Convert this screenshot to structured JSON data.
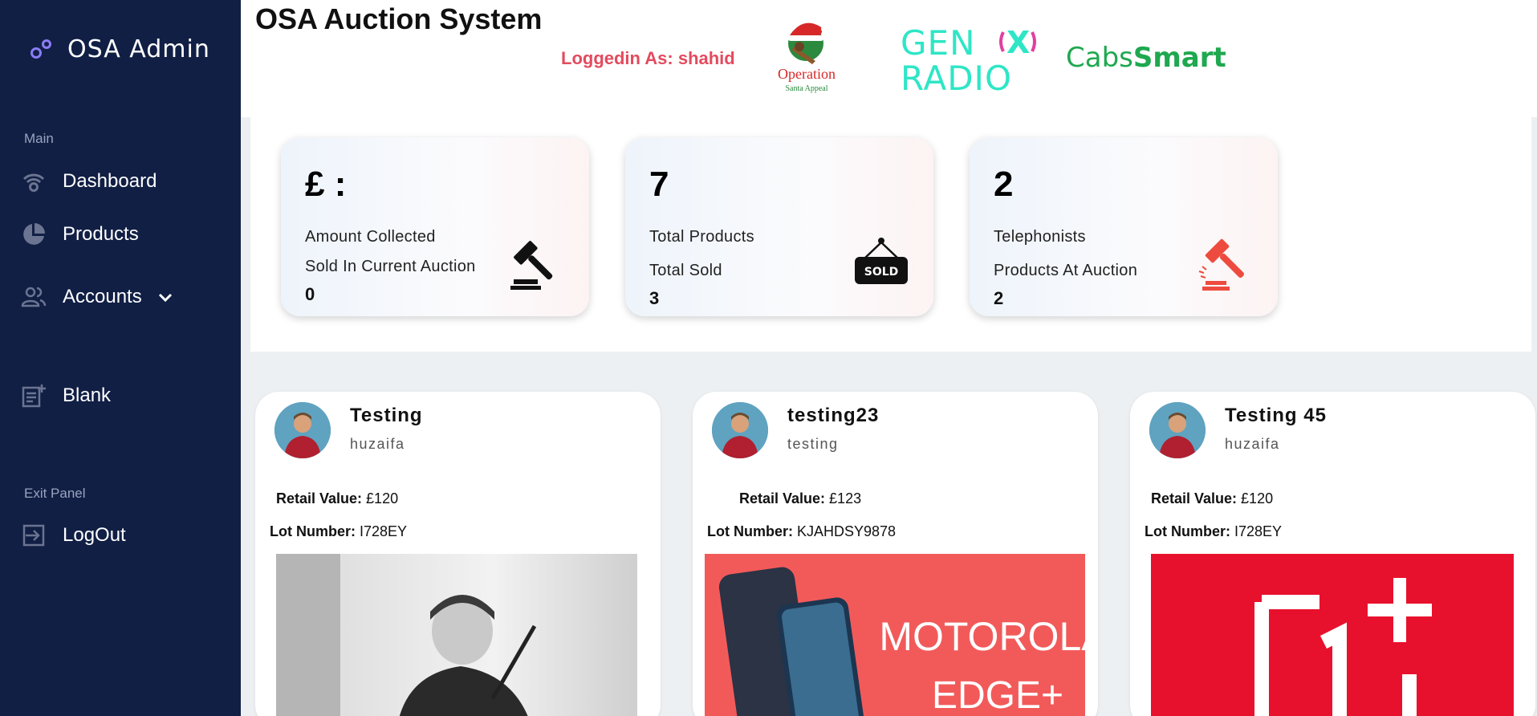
{
  "sidebar": {
    "brand": "OSA Admin",
    "sections": {
      "main": "Main",
      "exit": "Exit Panel"
    },
    "items": {
      "dashboard": "Dashboard",
      "products": "Products",
      "accounts": "Accounts",
      "blank": "Blank",
      "logout": "LogOut"
    }
  },
  "header": {
    "title": "OSA Auction System",
    "logged_in": "Loggedin As: shahid",
    "logos": {
      "operation_line1": "Operation",
      "operation_line2": "Santa Appeal",
      "genx_line1": "GEN",
      "genx_line2": "RADIO",
      "cabs_part1": "Cabs",
      "cabs_part2": "Smart"
    }
  },
  "stats": [
    {
      "big": "£ :",
      "label1": "Amount Collected",
      "label2": "Sold In Current Auction",
      "value": "0",
      "icon": "gavel-icon"
    },
    {
      "big": "7",
      "label1": "Total Products",
      "label2": "Total Sold",
      "value": "3",
      "icon": "sold-sign-icon",
      "sign_text": "SOLD"
    },
    {
      "big": "2",
      "label1": "Telephonists",
      "label2": "Products At Auction",
      "value": "2",
      "icon": "red-gavel-icon"
    }
  ],
  "products": [
    {
      "title": "Testing",
      "user": "huzaifa",
      "retail_label": "Retail Value:",
      "retail": " £120",
      "lot_label": "Lot Number:",
      "lot": " I728EY",
      "image": "security-guard-photo"
    },
    {
      "title": "testing23",
      "user": "testing",
      "retail_label": "Retail Value:",
      "retail": " £123",
      "lot_label": "Lot Number:",
      "lot": " KJAHDSY9878",
      "image": "motorola-phone-photo",
      "image_text1": "MOTOROLA",
      "image_text2": "EDGE+"
    },
    {
      "title": "Testing 45",
      "user": "huzaifa",
      "retail_label": "Retail Value:",
      "retail": " £120",
      "lot_label": "Lot Number:",
      "lot": " I728EY",
      "image": "oneplus-logo-photo"
    }
  ],
  "colors": {
    "sidebar": "#111f45",
    "accent_red": "#e34b5e",
    "genx": "#2ee6c6",
    "cabs": "#1fa84f"
  }
}
